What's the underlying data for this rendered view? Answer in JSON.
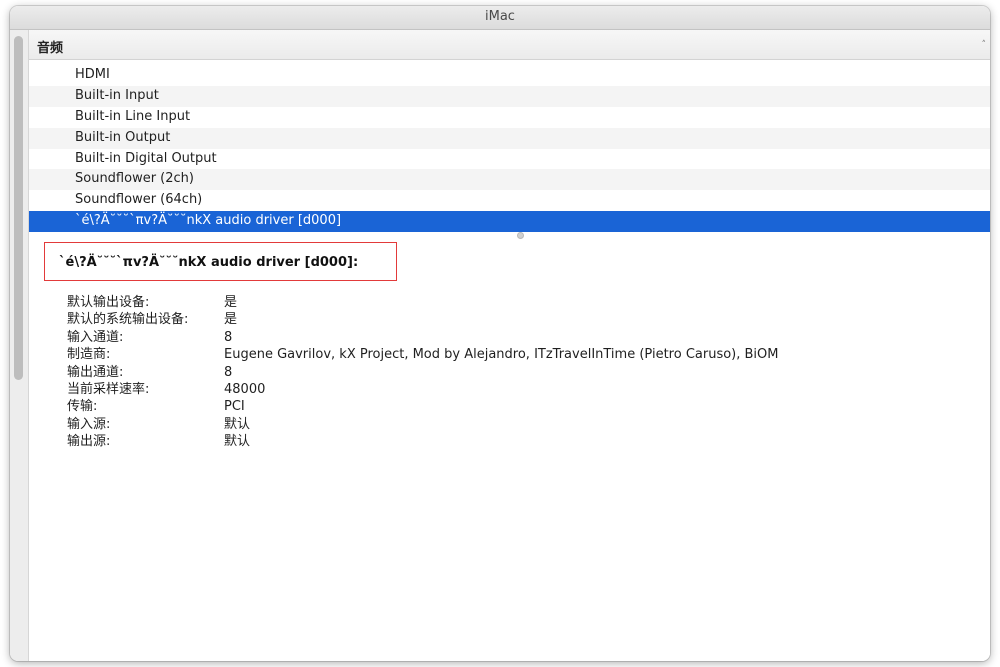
{
  "window": {
    "title": "iMac"
  },
  "section": {
    "title": "音频",
    "sort_glyph": "˄"
  },
  "devices": [
    {
      "label": "HDMI"
    },
    {
      "label": "Built-in Input"
    },
    {
      "label": "Built-in Line Input"
    },
    {
      "label": "Built-in Output"
    },
    {
      "label": "Built-in Digital Output"
    },
    {
      "label": "Soundflower (2ch)"
    },
    {
      "label": "Soundflower (64ch)"
    },
    {
      "label": "`é\\?Ä˘˘˘`πv?Ä˘˘˘nkX audio driver [d000]"
    }
  ],
  "selected_index": 7,
  "detail": {
    "title": "`é\\?Ä˘˘˘`πv?Ä˘˘˘nkX audio driver [d000]:",
    "properties": [
      {
        "key": "默认输出设备:",
        "value": "是"
      },
      {
        "key": "默认的系统输出设备:",
        "value": "是"
      },
      {
        "key": "输入通道:",
        "value": "8"
      },
      {
        "key": "制造商:",
        "value": "Eugene Gavrilov, kX Project, Mod by Alejandro, ITzTravelInTime (Pietro Caruso), BiOM"
      },
      {
        "key": "输出通道:",
        "value": "8"
      },
      {
        "key": "当前采样速率:",
        "value": "48000"
      },
      {
        "key": "传输:",
        "value": "PCI"
      },
      {
        "key": "输入源:",
        "value": "默认"
      },
      {
        "key": "输出源:",
        "value": "默认"
      }
    ]
  },
  "colors": {
    "selection": "#1a64d6",
    "highlight_box": "#e23a3a"
  }
}
